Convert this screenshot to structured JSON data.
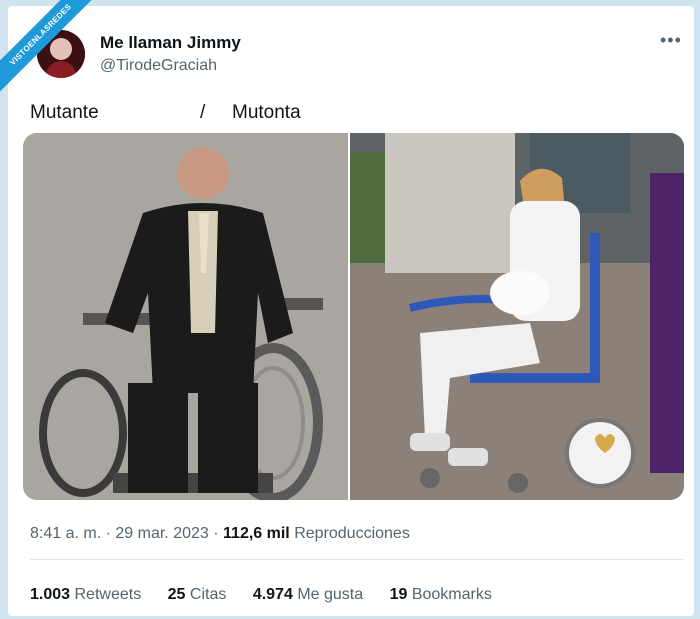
{
  "watermark": "VISTOENLASREDES",
  "author": {
    "display_name": "Me llaman Jimmy",
    "handle": "@TirodeGraciah"
  },
  "tweet": {
    "text_left": "Mutante",
    "text_sep": "/",
    "text_right": "Mutonta"
  },
  "meta": {
    "time": "8:41 a. m.",
    "dot": "·",
    "date": "29 mar. 2023",
    "views_count": "112,6 mil",
    "views_label": "Reproducciones"
  },
  "stats": [
    {
      "count": "1.003",
      "label": "Retweets"
    },
    {
      "count": "25",
      "label": "Citas"
    },
    {
      "count": "4.974",
      "label": "Me gusta"
    },
    {
      "count": "19",
      "label": "Bookmarks"
    }
  ],
  "icons": {
    "more": "more-horizontal-icon"
  }
}
